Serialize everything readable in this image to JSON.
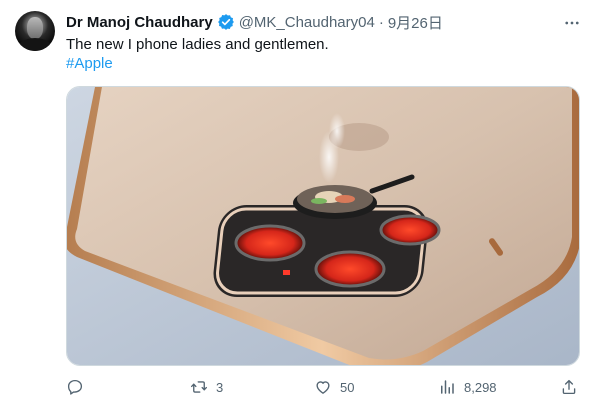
{
  "tweet": {
    "author_name": "Dr Manoj Chaudhary",
    "handle": "@MK_Chaudhary04",
    "separator": "·",
    "date": "9月26日",
    "text": "The new I phone ladies and gentlemen.",
    "hashtag": "#Apple"
  },
  "actions": {
    "replies": "",
    "retweets": "3",
    "likes": "50",
    "views": "8,298"
  },
  "colors": {
    "verified": "#1d9bf0",
    "link": "#1d9bf0",
    "muted": "#536471"
  }
}
